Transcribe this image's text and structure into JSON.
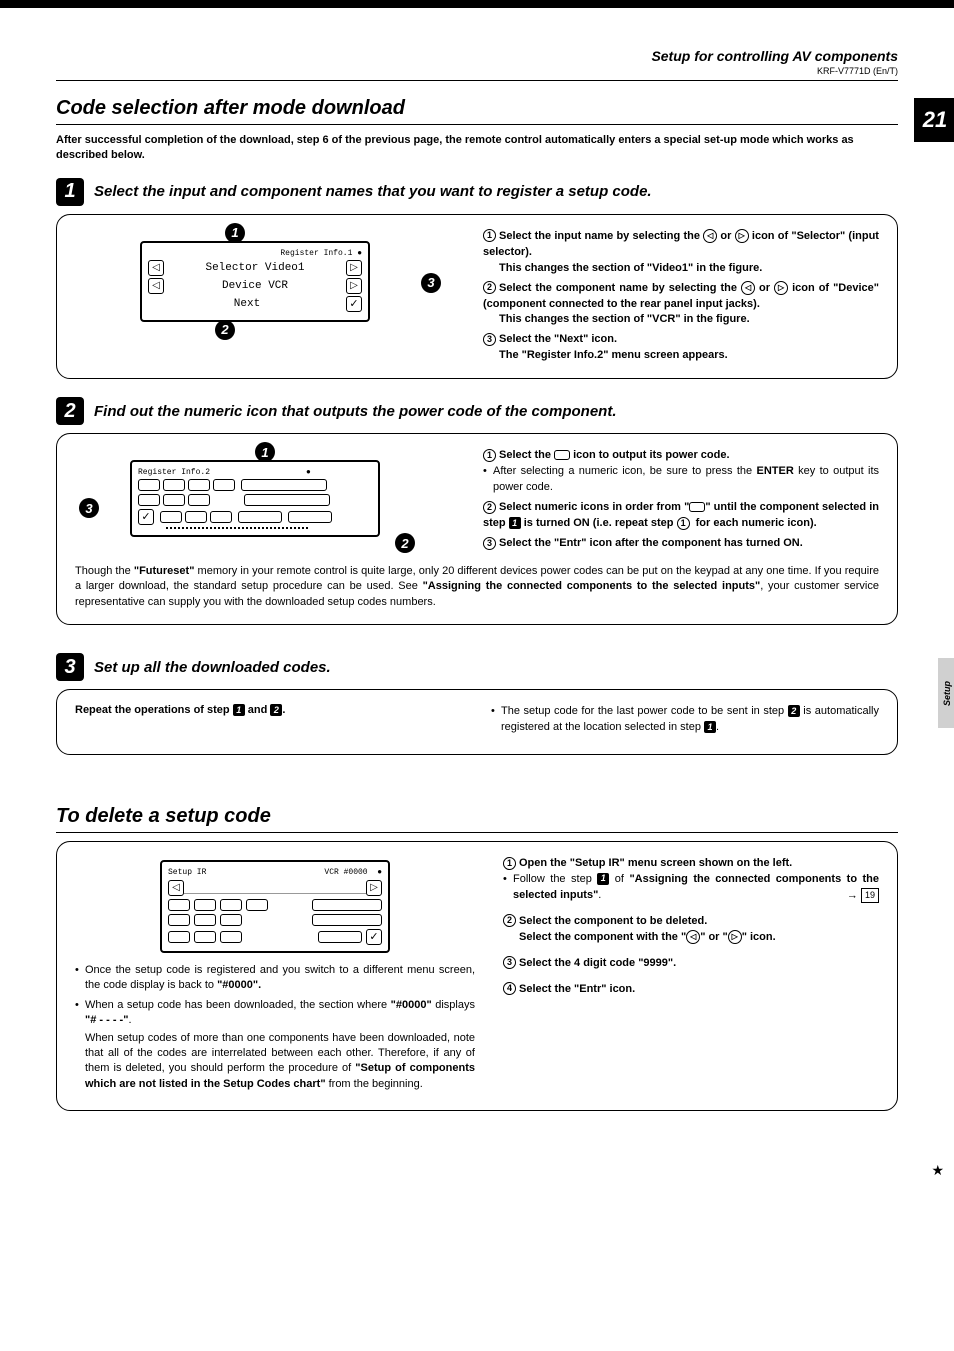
{
  "header": {
    "section": "Setup for controlling AV components",
    "model": "KRF-V7771D (En/T)",
    "page": "21",
    "side_tab": "Setup"
  },
  "title1": "Code selection after mode download",
  "intro": "After successful completion of the download, step 6 of the previous page, the remote control automatically enters a special set-up mode which works as described below.",
  "step1": {
    "num": "1",
    "title": "Select the input and component names that you want to register a setup code.",
    "lcd": {
      "row1_label": "Selector Video1",
      "row2_label": "Device VCR",
      "row3_label": "Next"
    },
    "r": {
      "a": "Select the input name by selecting the",
      "a2": "or",
      "a3": "icon of \"Selector\" (input selector).",
      "a_sub": "This changes the section of \"Video1\" in the figure.",
      "b": "Select the component name by selecting the",
      "b2": "or",
      "b3": "icon of \"Device\" (component connected to the rear panel input jacks).",
      "b_sub": "This changes the section of \"VCR\" in the figure.",
      "c": "Select the \"Next\" icon.",
      "c_sub": "The \"Register Info.2\" menu screen appears."
    }
  },
  "step2": {
    "num": "2",
    "title": "Find out the numeric icon that outputs the power code of the component.",
    "r": {
      "a": "Select the",
      "a2": "icon to output its power code.",
      "bullet": "After selecting a numeric icon, be sure to press the",
      "enter": "ENTER",
      "bullet2": "key to output its power code.",
      "b": "Select numeric icons in order from \"",
      "b2": "\" until the component selected in step",
      "b3": "is turned ON (i.e. repeat step",
      "b4": "for each numeric icon).",
      "c": "Select the \"Entr\" icon after the component has turned ON."
    },
    "note_a": "Though the",
    "note_future": "\"Futureset\"",
    "note_b": "memory in your remote control is quite large, only 20 different devices power codes can be put on the keypad at any one time. If you require a larger download, the standard setup procedure can be used. See",
    "note_bold": "\"Assigning the connected components to the selected inputs\"",
    "note_c": ", your customer service representative can supply you with the downloaded setup codes numbers."
  },
  "step3": {
    "num": "3",
    "title": "Set up all the downloaded codes.",
    "left": "Repeat the operations of step",
    "left2": "and",
    "right_a": "The setup code for the last power code to be sent in step",
    "right_b": "is automatically registered at the location selected in step"
  },
  "title2": "To delete a setup code",
  "delete": {
    "left_b1": "Once the setup code is registered and you switch to a different menu screen, the code display is back to",
    "left_b1_code": "\"#0000\".",
    "left_b2": "When a setup code has been downloaded, the section where",
    "left_b2_a": "\"#0000\"",
    "left_b2_b": "displays",
    "left_b2_c": "\"# - - - -\"",
    "left_b2_d": ".",
    "left_p": "When setup codes of more than one components have been downloaded, note that all of the codes are interrelated between each other. Therefore, if any of them is deleted, you should perform the procedure of",
    "left_p_bold": "\"Setup of components which are not listed in the Setup Codes chart\"",
    "left_p2": "from the beginning.",
    "r1": "Open the \"Setup IR\" menu screen shown on the left.",
    "r1b_a": "Follow the step",
    "r1b_b": "of",
    "r1b_bold": "\"Assigning the connected components to the selected inputs\"",
    "r1b_c": ".",
    "page_ref": "19",
    "r2a": "Select the component to be deleted.",
    "r2b": "Select the component with the \"",
    "r2c": "\" or \"",
    "r2d": "\" icon.",
    "r3": "Select the 4 digit code \"9999\".",
    "r4": "Select the \"Entr\" icon."
  }
}
